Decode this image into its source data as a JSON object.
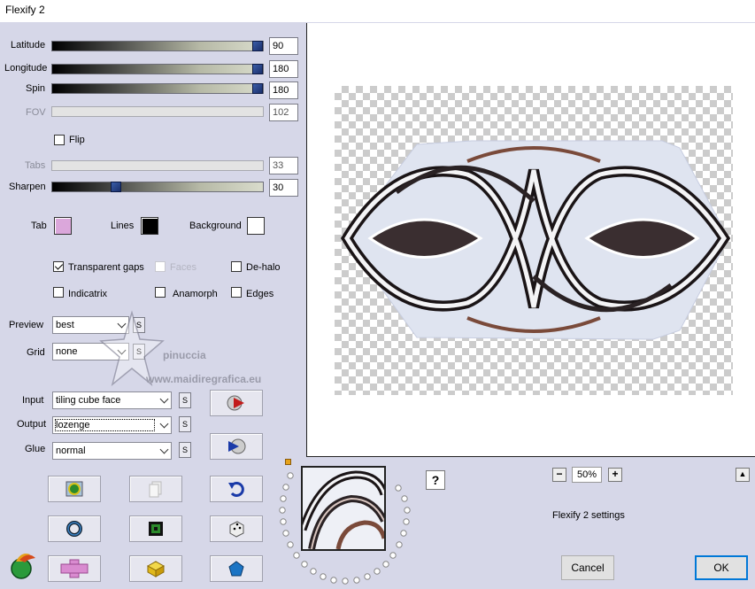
{
  "window": {
    "title": "Flexify 2"
  },
  "sliders": [
    {
      "label": "Latitude",
      "value": "90",
      "enabled": true,
      "fraction": 1.0
    },
    {
      "label": "Longitude",
      "value": "180",
      "enabled": true,
      "fraction": 1.0
    },
    {
      "label": "Spin",
      "value": "180",
      "enabled": true,
      "fraction": 1.0
    },
    {
      "label": "FOV",
      "value": "102",
      "enabled": false
    },
    {
      "label": "Tabs",
      "value": "33",
      "enabled": false
    },
    {
      "label": "Sharpen",
      "value": "30",
      "enabled": true,
      "fraction": 0.3
    }
  ],
  "flip": {
    "label": "Flip",
    "checked": false
  },
  "colors": {
    "tab": {
      "label": "Tab",
      "color": "#dba7db"
    },
    "lines": {
      "label": "Lines",
      "color": "#000000"
    },
    "background": {
      "label": "Background",
      "color": "#ffffff"
    }
  },
  "options": {
    "transparent_gaps": {
      "label": "Transparent gaps",
      "checked": true
    },
    "faces": {
      "label": "Faces",
      "checked": false,
      "enabled": false
    },
    "de_halo": {
      "label": "De-halo",
      "checked": false
    },
    "indicatrix": {
      "label": "Indicatrix",
      "checked": false
    },
    "anamorph": {
      "label": "Anamorph",
      "checked": false
    },
    "edges": {
      "label": "Edges",
      "checked": false
    }
  },
  "selects": {
    "preview": {
      "label": "Preview",
      "value": "best"
    },
    "grid": {
      "label": "Grid",
      "value": "none"
    },
    "input": {
      "label": "Input",
      "value": "tiling cube face"
    },
    "output": {
      "label": "Output",
      "value": "lozenge"
    },
    "glue": {
      "label": "Glue",
      "value": "normal"
    }
  },
  "s_button_label": "S",
  "watermark": {
    "name": "pinuccia",
    "url": "www.maidiregrafica.eu"
  },
  "zoom": {
    "value": "50%",
    "minus": "−",
    "plus": "+"
  },
  "help": "?",
  "collapse": "▲",
  "settings_name": "Flexify 2 settings",
  "buttons": {
    "cancel": "Cancel",
    "ok": "OK"
  },
  "icon_colors": {
    "accent": "#0078d7",
    "preset_pink": "#d98bd0",
    "green": "#2b8a2b",
    "yellow": "#e6c21a",
    "blue": "#1b74c4"
  }
}
